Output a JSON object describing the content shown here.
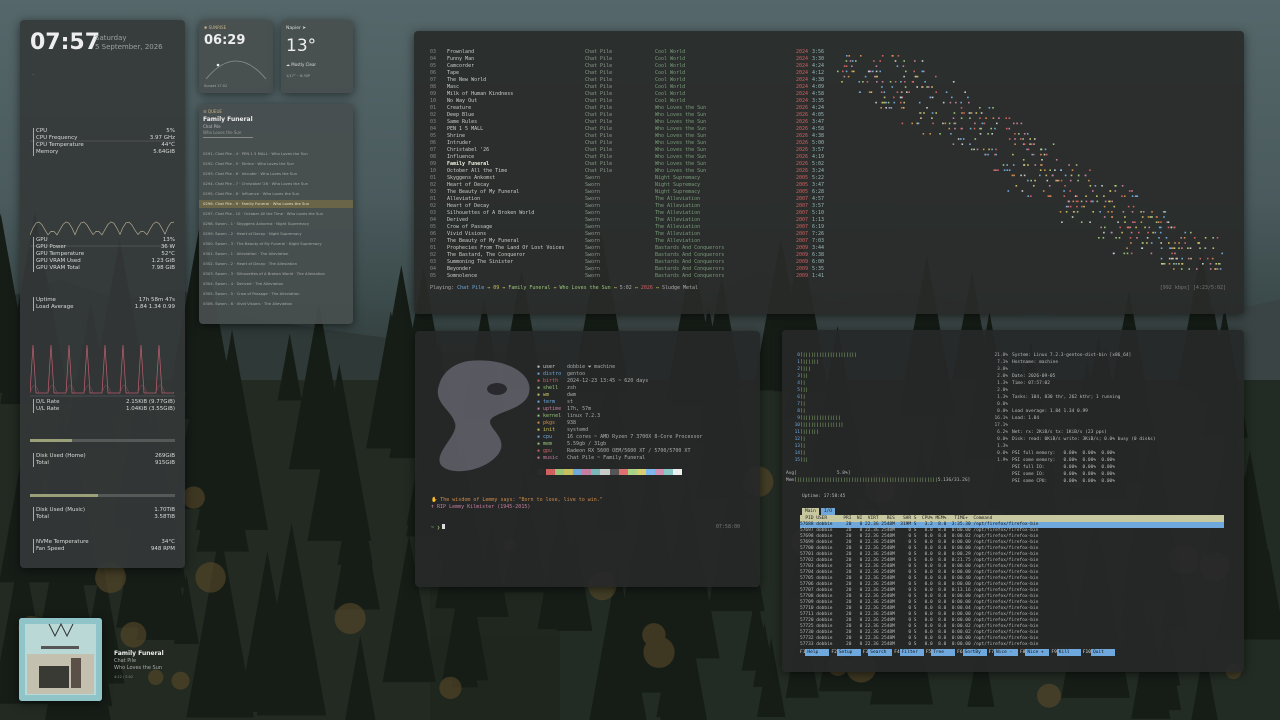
{
  "colors": {
    "accent_green": "#98c379",
    "accent_blue": "#6fa8dc",
    "accent_orange": "#d08c4a",
    "accent_red": "#d06060",
    "accent_pink": "#c47ea0",
    "accent_yellow": "#c8c060"
  },
  "sysmon": {
    "time": "07:57",
    "weekday": "Saturday",
    "date": "5 September, 2026",
    "cpu": [
      {
        "k": "CPU",
        "v": "5%"
      },
      {
        "k": "CPU Frequency",
        "v": "3.97 GHz"
      },
      {
        "k": "CPU Temperature",
        "v": "44°C"
      },
      {
        "k": "Memory",
        "v": "5.64GiB"
      }
    ],
    "gpu": [
      {
        "k": "GPU",
        "v": "13%"
      },
      {
        "k": "GPU Power",
        "v": "36 W"
      },
      {
        "k": "GPU Temperature",
        "v": "52°C"
      },
      {
        "k": "GPU VRAM Used",
        "v": "1.23 GiB"
      },
      {
        "k": "GPU VRAM Total",
        "v": "7.98 GiB"
      }
    ],
    "sys": [
      {
        "k": "Uptime",
        "v": "17h 58m 47s"
      },
      {
        "k": "Load Average",
        "v": "1.84 1.34 0.99"
      }
    ],
    "net": [
      {
        "k": "D/L Rate",
        "v": "2.15KiB (9.77GiB)"
      },
      {
        "k": "U/L Rate",
        "v": "1.04KiB (3.55GiB)"
      }
    ],
    "home": [
      {
        "k": "Disk Used (Home)",
        "v": "269GiB"
      },
      {
        "k": "Total",
        "v": "915GiB"
      }
    ],
    "home_fill": 0.29,
    "music": [
      {
        "k": "Disk Used (Music)",
        "v": "1.70TiB"
      },
      {
        "k": "Total",
        "v": "3.58TiB"
      }
    ],
    "music_fill": 0.47,
    "misc": [
      {
        "k": "NVMe Temperature",
        "v": "34°C"
      },
      {
        "k": "Fan Speed",
        "v": "948 RPM"
      }
    ]
  },
  "sunrise": {
    "label": "SUNRISE",
    "time": "06:29",
    "sunset": "Sunset 17:52"
  },
  "weather": {
    "city": "Napier",
    "temp": "13°",
    "condition": "Mostly Clear",
    "detail": "1/17° ·· 8:30P"
  },
  "queue": {
    "label": "QUEUE",
    "title": "Family Funeral",
    "artist": "Chat Pile",
    "album": "Who Loves the Sun",
    "items": [
      "0291. Chat Pile - 4 · PEN 1 5 MALL · Who Loves the Sun",
      "0292. Chat Pile - 5 · Shrine · Who Loves the Sun",
      "0293. Chat Pile - 6 · Intruder · Who Loves the Sun",
      "0294. Chat Pile - 7 · Christabel '26 · Who Loves the Sun",
      "0295. Chat Pile - 8 · Influence · Who Loves the Sun",
      "0296. Chat Pile - 9 · Family Funeral · Who Loves the Sun",
      "0297. Chat Pile - 10 · October All the Time · Who Loves the Sun",
      "0298. Sworn - 1 · Skyggens Ankomst · Night Supremacy",
      "0299. Sworn - 2 · Heart of Decay · Night Supremacy",
      "0300. Sworn - 3 · The Beauty of My Funeral · Night Supremacy",
      "0301. Sworn - 1 · Alleviation · The Alleviation",
      "0302. Sworn - 2 · Heart of Decay · The Alleviation",
      "0303. Sworn - 3 · Silhouettes of A Broken World · The Alleviation",
      "0304. Sworn - 4 · Derived · The Alleviation",
      "0305. Sworn - 5 · Crow of Passage · The Alleviation",
      "0306. Sworn - 6 · Vivid Visions · The Alleviation"
    ]
  },
  "album": {
    "title": "Family Funeral",
    "artist": "Chat Pile",
    "album": "Who Loves the Sun",
    "progress": "4:22 / 5:02"
  },
  "player": {
    "tracks": [
      [
        "03",
        "Frownland",
        "Chat Pile",
        "Cool World",
        "2024",
        "3:56"
      ],
      [
        "04",
        "Funny Man",
        "Chat Pile",
        "Cool World",
        "2024",
        "3:30"
      ],
      [
        "05",
        "Camcorder",
        "Chat Pile",
        "Cool World",
        "2024",
        "4:24"
      ],
      [
        "06",
        "Tape",
        "Chat Pile",
        "Cool World",
        "2024",
        "4:12"
      ],
      [
        "07",
        "The New World",
        "Chat Pile",
        "Cool World",
        "2024",
        "4:38"
      ],
      [
        "08",
        "Masc",
        "Chat Pile",
        "Cool World",
        "2024",
        "4:09"
      ],
      [
        "09",
        "Milk of Human Kindness",
        "Chat Pile",
        "Cool World",
        "2024",
        "4:58"
      ],
      [
        "10",
        "No Way Out",
        "Chat Pile",
        "Cool World",
        "2024",
        "3:35"
      ],
      [
        "01",
        "Creature",
        "Chat Pile",
        "Who Loves the Sun",
        "2026",
        "4:24"
      ],
      [
        "02",
        "Deep Blue",
        "Chat Pile",
        "Who Loves the Sun",
        "2026",
        "4:05"
      ],
      [
        "03",
        "Same Rules",
        "Chat Pile",
        "Who Loves the Sun",
        "2026",
        "3:47"
      ],
      [
        "04",
        "PEN 1 5 MALL",
        "Chat Pile",
        "Who Loves the Sun",
        "2026",
        "4:58"
      ],
      [
        "05",
        "Shrine",
        "Chat Pile",
        "Who Loves the Sun",
        "2026",
        "4:38"
      ],
      [
        "06",
        "Intruder",
        "Chat Pile",
        "Who Loves the Sun",
        "2026",
        "5:00"
      ],
      [
        "07",
        "Christabel '26",
        "Chat Pile",
        "Who Loves the Sun",
        "2026",
        "3:57"
      ],
      [
        "08",
        "Influence",
        "Chat Pile",
        "Who Loves the Sun",
        "2026",
        "4:19"
      ],
      [
        "09",
        "Family Funeral",
        "Chat Pile",
        "Who Loves the Sun",
        "2026",
        "5:02"
      ],
      [
        "10",
        "October All the Time",
        "Chat Pile",
        "Who Loves the Sun",
        "2026",
        "3:24"
      ],
      [
        "01",
        "Skyggens Ankomst",
        "Sworn",
        "Night Supremacy",
        "2005",
        "5:22"
      ],
      [
        "02",
        "Heart of Decay",
        "Sworn",
        "Night Supremacy",
        "2005",
        "3:47"
      ],
      [
        "03",
        "The Beauty of My Funeral",
        "Sworn",
        "Night Supremacy",
        "2005",
        "6:28"
      ],
      [
        "01",
        "Alleviation",
        "Sworn",
        "The Alleviation",
        "2007",
        "4:57"
      ],
      [
        "02",
        "Heart of Decay",
        "Sworn",
        "The Alleviation",
        "2007",
        "3:57"
      ],
      [
        "03",
        "Silhouettes of A Broken World",
        "Sworn",
        "The Alleviation",
        "2007",
        "5:10"
      ],
      [
        "04",
        "Derived",
        "Sworn",
        "The Alleviation",
        "2007",
        "1:13"
      ],
      [
        "05",
        "Crow of Passage",
        "Sworn",
        "The Alleviation",
        "2007",
        "6:19"
      ],
      [
        "06",
        "Vivid Visions",
        "Sworn",
        "The Alleviation",
        "2007",
        "7:26"
      ],
      [
        "07",
        "The Beauty of My Funeral",
        "Sworn",
        "The Alleviation",
        "2007",
        "7:03"
      ],
      [
        "01",
        "Prophecies From The Land Of Lost Voices",
        "Sworn",
        "Bastards And Conquerors",
        "2009",
        "3:44"
      ],
      [
        "02",
        "The Bastard, The Conqueror",
        "Sworn",
        "Bastards And Conquerors",
        "2009",
        "6:38"
      ],
      [
        "03",
        "Summoning The Sinister",
        "Sworn",
        "Bastards And Conquerors",
        "2009",
        "6:00"
      ],
      [
        "04",
        "Beyonder",
        "Sworn",
        "Bastards And Conquerors",
        "2009",
        "5:35"
      ],
      [
        "05",
        "Somnolence",
        "Sworn",
        "Bastards And Conquerors",
        "2009",
        "1:41"
      ]
    ],
    "status_prefix": "Playing:",
    "status_artist": "Chat Pile",
    "status_num": "09",
    "status_title": "Family Funeral",
    "status_album": "Who Loves the Sun",
    "status_len": "5:02",
    "status_year": "2026",
    "status_genre": "Sludge Metal",
    "status_right": "[992 kbps] [4:23/5:02]"
  },
  "fetch": {
    "info": [
      [
        "user",
        "dobbie ❤ machine"
      ],
      [
        "distro",
        "gentoo"
      ],
      [
        "birth",
        "2024-12-23 13:45 ~ 620 days"
      ],
      [
        "shell",
        "zsh"
      ],
      [
        "wm",
        "dwm"
      ],
      [
        "term",
        "st"
      ],
      [
        "uptime",
        "17h, 57m"
      ],
      [
        "kernel",
        "linux 7.2.3"
      ],
      [
        "pkgs",
        "938"
      ],
      [
        "init",
        "systemd"
      ],
      [
        "cpu",
        "16 cores ~ AMD Ryzen 7 3700X 8-Core Processor"
      ],
      [
        "mem",
        "5.59gb / 31gb"
      ],
      [
        "gpu",
        "Radeon RX 5600 OEM/5600 XT / 5700/5700 XT"
      ],
      [
        "music",
        "Chat Pile ~ Family Funeral"
      ]
    ],
    "quote": "The wisdom of Lemmy says: \"Born to lose, live to win.\"",
    "rip": "RIP Lemmy Kilmister (1945-2015)",
    "prompt": "~ ❯",
    "clock": "07:58:00"
  },
  "htop": {
    "cpus": [
      [
        "0",
        "21.8%"
      ],
      [
        "1",
        "7.1%"
      ],
      [
        "2",
        "3.8%"
      ],
      [
        "3",
        "2.0%"
      ],
      [
        "4",
        "1.3%"
      ],
      [
        "5",
        "2.0%"
      ],
      [
        "6",
        "1.3%"
      ],
      [
        "7",
        "0.0%"
      ],
      [
        "8",
        "0.0%"
      ],
      [
        "9",
        "16.1%"
      ],
      [
        "10",
        "17.1%"
      ],
      [
        "11",
        "6.2%"
      ],
      [
        "12",
        "0.0%"
      ],
      [
        "13",
        "1.3%"
      ],
      [
        "14",
        "0.0%"
      ],
      [
        "15",
        "1.9%"
      ]
    ],
    "avg": "5.8%",
    "mem": "5.13G/31.2G",
    "sys": [
      "System: Linux 7.2.3-gentoo-dist-bin [x86_64]",
      "Hostname: machine",
      "",
      "Date: 2026-09-05",
      "Time: 07:57:02",
      "",
      "Tasks: 104, 830 thr, 262 kthr; 1 running",
      "",
      "Load average: 1.84 1.34 0.99",
      "Load: 1.84",
      "",
      "Net: rx: 2KiB/s tx: 1KiB/s (23 pps)",
      "Disk: read: 0KiB/s write: 3KiB/s; 0.0% busy (0 disks)",
      "",
      "PSI full memory:   0.00%  0.00%  0.00%",
      "PSI some memory:   0.00%  0.00%  0.00%",
      "PSI full IO:       0.00%  0.00%  0.00%",
      "PSI some IO:       0.00%  0.00%  0.00%",
      "PSI some CPU:      0.00%  0.00%  0.00%"
    ],
    "uptime": "Uptime: 17:58:45",
    "tabs": [
      "Main",
      "I/O"
    ],
    "header": "  PID USER      PRI  NI  VIRT   RES   SHR S  CPU% MEM%   TIME+  Command",
    "procs": [
      "57688 dobbie     20   0 22.3G 2548M  319M S   3.2  8.0  3:35.30 /opt/firefox/firefox-bin",
      "57697 dobbie     20   0 22.3G 2548M     0 S   0.0  8.0  0:00.00 /opt/firefox/firefox-bin",
      "57698 dobbie     20   0 22.3G 2548M     0 S   0.0  8.0  0:00.02 /opt/firefox/firefox-bin",
      "57699 dobbie     20   0 22.3G 2548M     0 S   0.0  8.0  0:00.00 /opt/firefox/firefox-bin",
      "57700 dobbie     20   0 22.3G 2548M     0 S   0.0  8.0  0:00.00 /opt/firefox/firefox-bin",
      "57701 dobbie     20   0 22.3G 2548M     0 S   0.0  8.0  0:00.29 /opt/firefox/firefox-bin",
      "57702 dobbie     20   0 22.3G 2548M     0 S   0.0  8.0  0:21.75 /opt/firefox/firefox-bin",
      "57703 dobbie     20   0 22.3G 2548M     0 S   0.0  8.0  0:00.00 /opt/firefox/firefox-bin",
      "57704 dobbie     20   0 22.3G 2548M     0 S   0.0  8.0  0:00.00 /opt/firefox/firefox-bin",
      "57705 dobbie     20   0 22.3G 2548M     0 S   0.0  8.0  0:00.40 /opt/firefox/firefox-bin",
      "57706 dobbie     20   0 22.3G 2548M     0 S   0.0  8.0  0:00.00 /opt/firefox/firefox-bin",
      "57707 dobbie     20   0 22.3G 2548M     0 S   0.0  8.0  0:13.16 /opt/firefox/firefox-bin",
      "57708 dobbie     20   0 22.3G 2548M     0 S   0.0  8.0  0:00.00 /opt/firefox/firefox-bin",
      "57709 dobbie     20   0 22.3G 2548M     0 S   0.0  8.0  0:00.00 /opt/firefox/firefox-bin",
      "57710 dobbie     20   0 22.3G 2548M     0 S   0.0  8.0  0:00.04 /opt/firefox/firefox-bin",
      "57711 dobbie     20   0 22.3G 2548M     0 S   0.0  8.0  0:00.00 /opt/firefox/firefox-bin",
      "57720 dobbie     20   0 22.3G 2548M     0 S   0.0  8.0  0:00.00 /opt/firefox/firefox-bin",
      "57725 dobbie     20   0 22.3G 2548M     0 S   0.0  8.0  0:00.02 /opt/firefox/firefox-bin",
      "57730 dobbie     20   0 22.3G 2548M     0 S   0.0  8.0  0:00.02 /opt/firefox/firefox-bin",
      "57732 dobbie     20   0 22.3G 2548M     0 S   0.0  8.0  0:00.00 /opt/firefox/firefox-bin",
      "57733 dobbie     20   0 22.3G 2548M     0 S   0.0  8.0  0:00.00 /opt/firefox/firefox-bin"
    ],
    "fkeys": [
      [
        "F1",
        "Help"
      ],
      [
        "F2",
        "Setup"
      ],
      [
        "F3",
        "Search"
      ],
      [
        "F4",
        "Filter"
      ],
      [
        "F5",
        "Tree"
      ],
      [
        "F6",
        "SortBy"
      ],
      [
        "F7",
        "Nice -"
      ],
      [
        "F8",
        "Nice +"
      ],
      [
        "F9",
        "Kill"
      ],
      [
        "F10",
        "Quit"
      ]
    ]
  }
}
